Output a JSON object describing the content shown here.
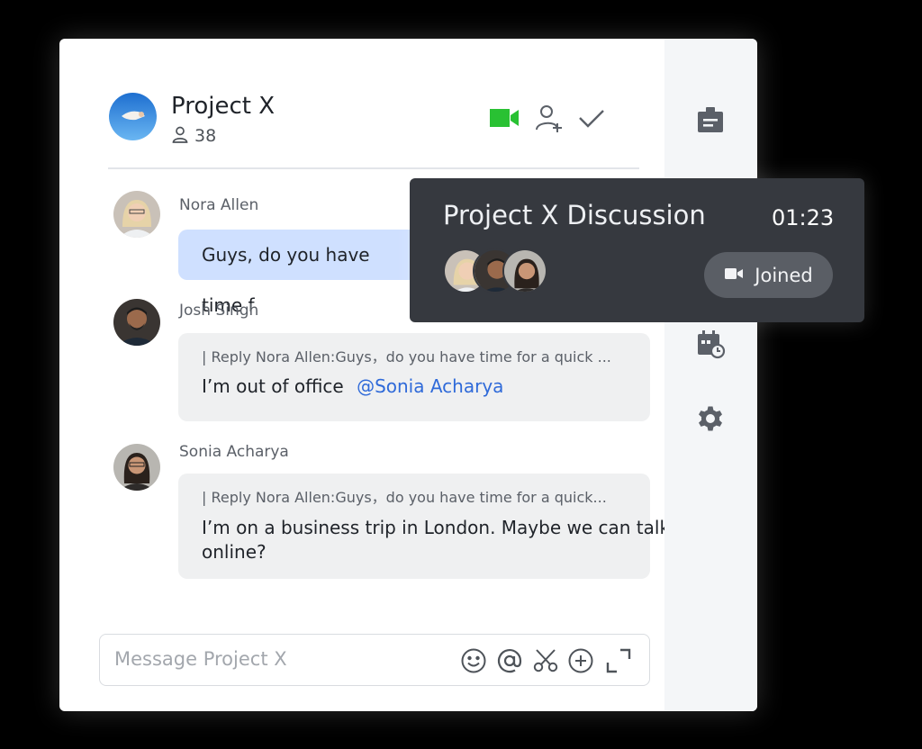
{
  "header": {
    "title": "Project X",
    "member_count": "38",
    "icons": [
      "video-call-icon",
      "add-member-icon",
      "check-icon"
    ]
  },
  "colors": {
    "accent_green": "#29c133",
    "bubble_blue": "#cfe0ff",
    "bubble_gray": "#eff0f1",
    "mention_blue": "#2f6ad9",
    "call_card_bg": "#36393f"
  },
  "messages": [
    {
      "sender": "Nora Allen",
      "text": "Guys, do you have time f"
    },
    {
      "sender": "Josh Singh",
      "reply_quote": "| Reply Nora Allen:Guys，do you have time for a quick ...",
      "text": "I’m out of office",
      "mention": "@Sonia Acharya"
    },
    {
      "sender": "Sonia Acharya",
      "reply_quote": "| Reply Nora Allen:Guys，do you have time for a quick...",
      "text_line1": "I’m on a business trip in London. Maybe we can talk",
      "text_line2": "online?"
    }
  ],
  "composer": {
    "placeholder": "Message Project X",
    "icons": [
      "emoji-icon",
      "mention-icon",
      "scissors-icon",
      "add-icon",
      "expand-icon"
    ]
  },
  "right_rail": {
    "icons": [
      "announcement-icon",
      "schedule-icon",
      "settings-icon"
    ]
  },
  "call": {
    "title": "Project X Discussion",
    "timer": "01:23",
    "joined_label": "Joined"
  }
}
